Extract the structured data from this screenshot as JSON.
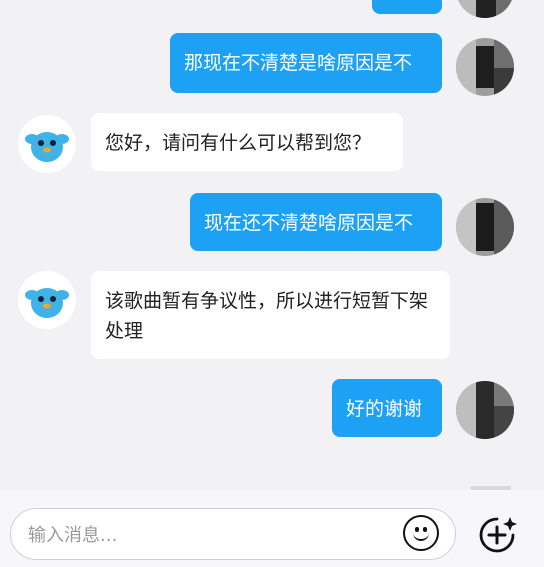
{
  "messages": [
    {
      "side": "out",
      "text": ""
    },
    {
      "side": "out",
      "text": "那现在不清楚是啥原因是不"
    },
    {
      "side": "in",
      "text": "您好，请问有什么可以帮到您？"
    },
    {
      "side": "out",
      "text": "现在还不清楚啥原因是不"
    },
    {
      "side": "in",
      "text": "该歌曲暂有争议性，所以进行短暂下架处理"
    },
    {
      "side": "out",
      "text": "好的谢谢"
    }
  ],
  "composer": {
    "placeholder": "输入消息...",
    "emoji_icon": "smiley-face-icon",
    "add_icon": "plus-sparkle-icon"
  },
  "colors": {
    "outgoing_bubble": "#1da1f5",
    "incoming_bubble": "#ffffff",
    "background": "#f2f2f4"
  }
}
